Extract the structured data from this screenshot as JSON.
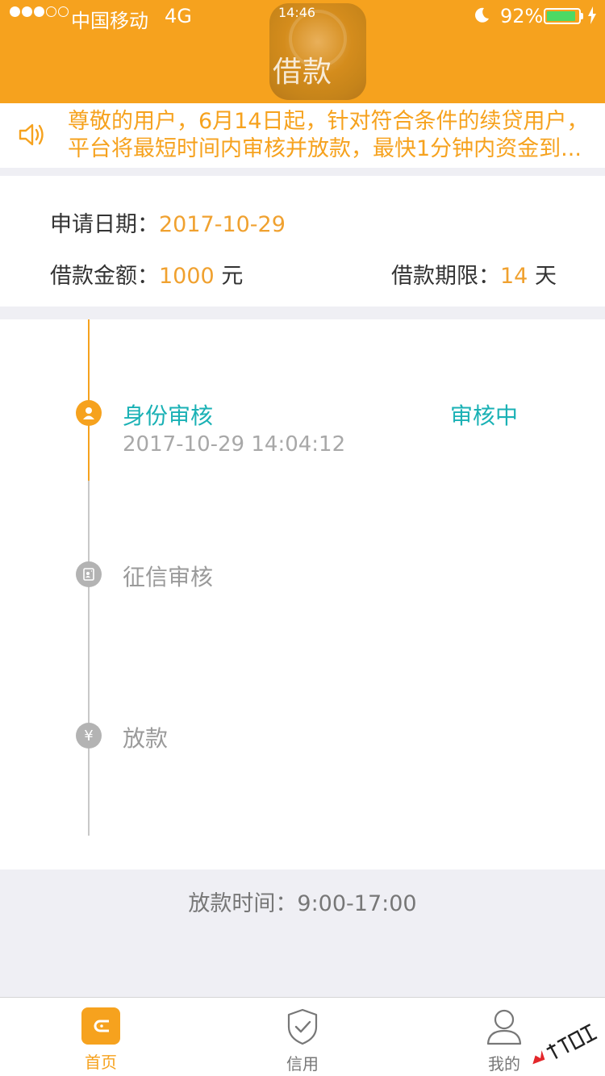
{
  "status_bar": {
    "carrier": "中国移动",
    "network": "4G",
    "time": "14:46",
    "battery": "92%",
    "battery_level": 0.92
  },
  "header": {
    "title": "借款"
  },
  "notice": {
    "line1": "尊敬的用户，6月14日起，针对符合条件的续贷用户，",
    "line2": "平台将最短时间内审核并放款，最快1分钟内资金到..."
  },
  "summary": {
    "apply_date_label": "申请日期：",
    "apply_date": "2017-10-29",
    "amount_label": "借款金额：",
    "amount": "1000",
    "amount_unit": "元",
    "term_label": "借款期限：",
    "term": "14",
    "term_unit": "天"
  },
  "timeline": {
    "steps": [
      {
        "title": "身份审核",
        "status": "审核中",
        "time": "2017-10-29 14:04:12",
        "icon": "person-icon",
        "state": "active"
      },
      {
        "title": "征信审核",
        "icon": "credit-report-icon",
        "state": "inactive"
      },
      {
        "title": "放款",
        "icon": "yen-icon",
        "glyph": "¥",
        "state": "inactive"
      }
    ]
  },
  "disburse_time": "放款时间：9:00-17:00",
  "tabbar": {
    "tabs": [
      {
        "label": "首页",
        "icon": "wallet-icon",
        "active": true
      },
      {
        "label": "信用",
        "icon": "shield-check-icon",
        "active": false
      },
      {
        "label": "我的",
        "icon": "user-icon",
        "active": false
      }
    ]
  },
  "colors": {
    "accent": "#f6a21e",
    "teal": "#1ab1b5",
    "value": "#f0a12f"
  }
}
